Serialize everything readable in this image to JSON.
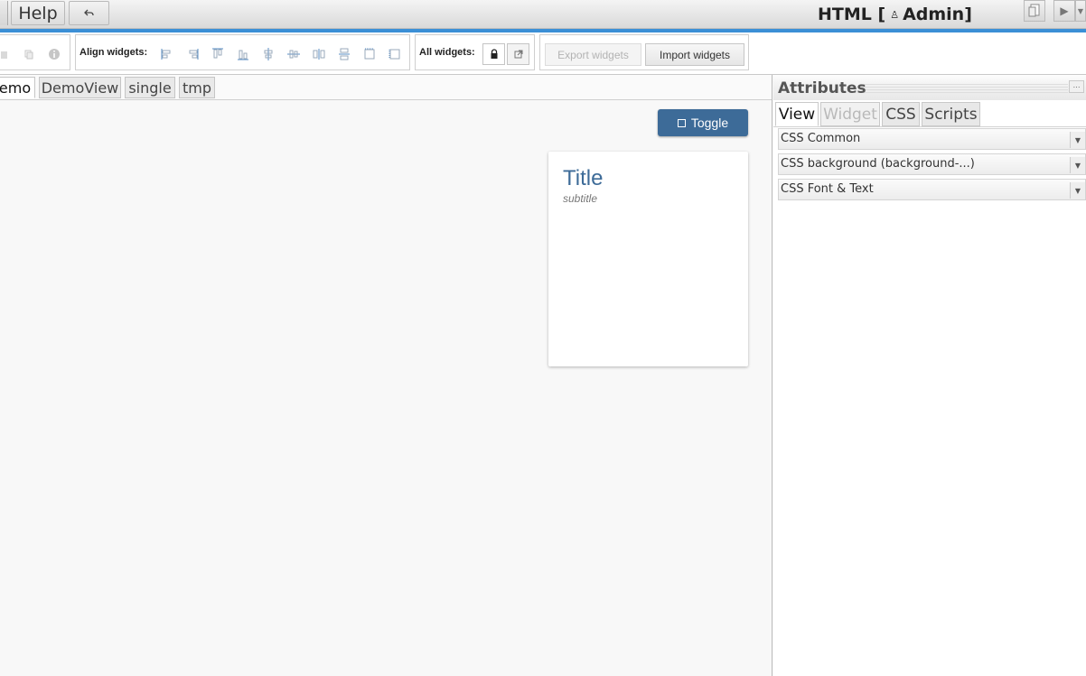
{
  "menubar": {
    "help_label": "Help",
    "undo_icon": "undo-icon",
    "app_title": "HTML [",
    "user_icon_glyph": "♙",
    "user_name": "Admin]"
  },
  "toolbar": {
    "align_label": "Align widgets:",
    "all_label": "All widgets:",
    "export_label": "Export widgets",
    "import_label": "Import widgets"
  },
  "views": {
    "tabs": [
      {
        "label": "emo",
        "active": true
      },
      {
        "label": "DemoView",
        "active": false
      },
      {
        "label": "single",
        "active": false
      },
      {
        "label": "tmp",
        "active": false
      }
    ]
  },
  "widgets": {
    "toggle_label": "Toggle",
    "card_title": "Title",
    "card_subtitle": "subtitle"
  },
  "attributes": {
    "title": "Attributes",
    "tabs": [
      {
        "label": "View",
        "state": "active"
      },
      {
        "label": "Widget",
        "state": "disabled"
      },
      {
        "label": "CSS",
        "state": "normal"
      },
      {
        "label": "Scripts",
        "state": "normal"
      }
    ],
    "sections": [
      {
        "label": "CSS Common"
      },
      {
        "label": "CSS background (background-...)"
      },
      {
        "label": "CSS Font & Text"
      }
    ]
  },
  "colors": {
    "accent": "#3b8fd6",
    "primary_button": "#3d6b98",
    "card_title": "#3d6b98"
  }
}
